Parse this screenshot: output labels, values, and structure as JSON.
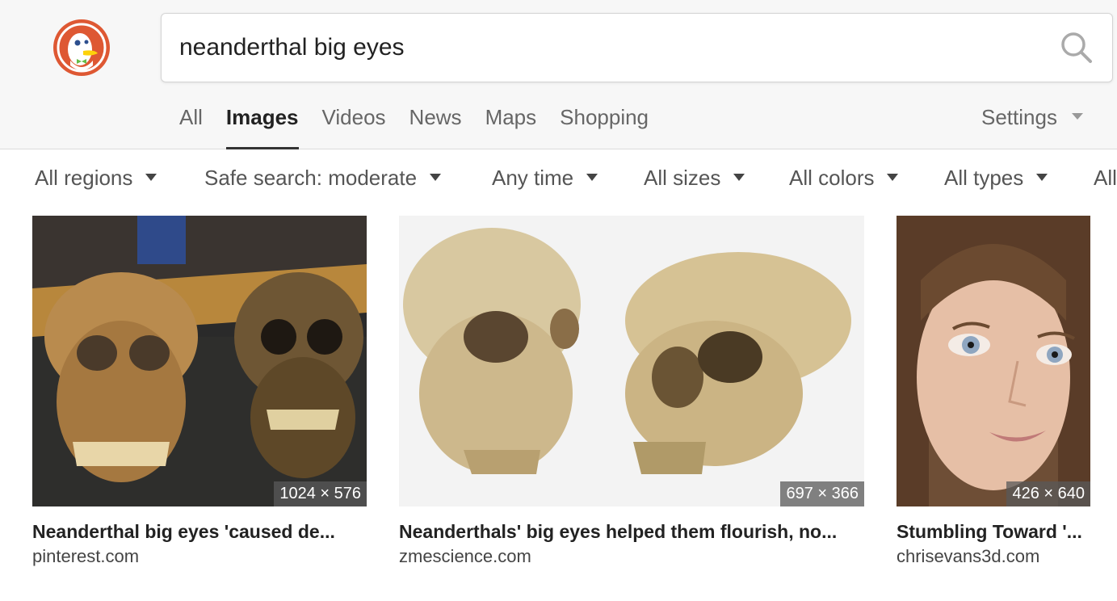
{
  "search": {
    "query": "neanderthal big eyes"
  },
  "icons": {
    "logo": "duckduckgo-logo",
    "search": "search-icon"
  },
  "nav": {
    "tabs": [
      {
        "label": "All",
        "active": false
      },
      {
        "label": "Images",
        "active": true
      },
      {
        "label": "Videos",
        "active": false
      },
      {
        "label": "News",
        "active": false
      },
      {
        "label": "Maps",
        "active": false
      },
      {
        "label": "Shopping",
        "active": false
      }
    ],
    "settings_label": "Settings"
  },
  "filters": [
    "All regions",
    "Safe search: moderate",
    "Any time",
    "All sizes",
    "All colors",
    "All types",
    "All"
  ],
  "results": [
    {
      "title": "Neanderthal big eyes 'caused de...",
      "source": "pinterest.com",
      "dimensions": "1024 × 576"
    },
    {
      "title": "Neanderthals' big eyes helped them flourish, no...",
      "source": "zmescience.com",
      "dimensions": "697 × 366"
    },
    {
      "title": "Stumbling Toward '...",
      "source": "chrisevans3d.com",
      "dimensions": "426 × 640"
    }
  ],
  "colors": {
    "brand": "#de5833",
    "header_bg": "#f7f7f7"
  }
}
